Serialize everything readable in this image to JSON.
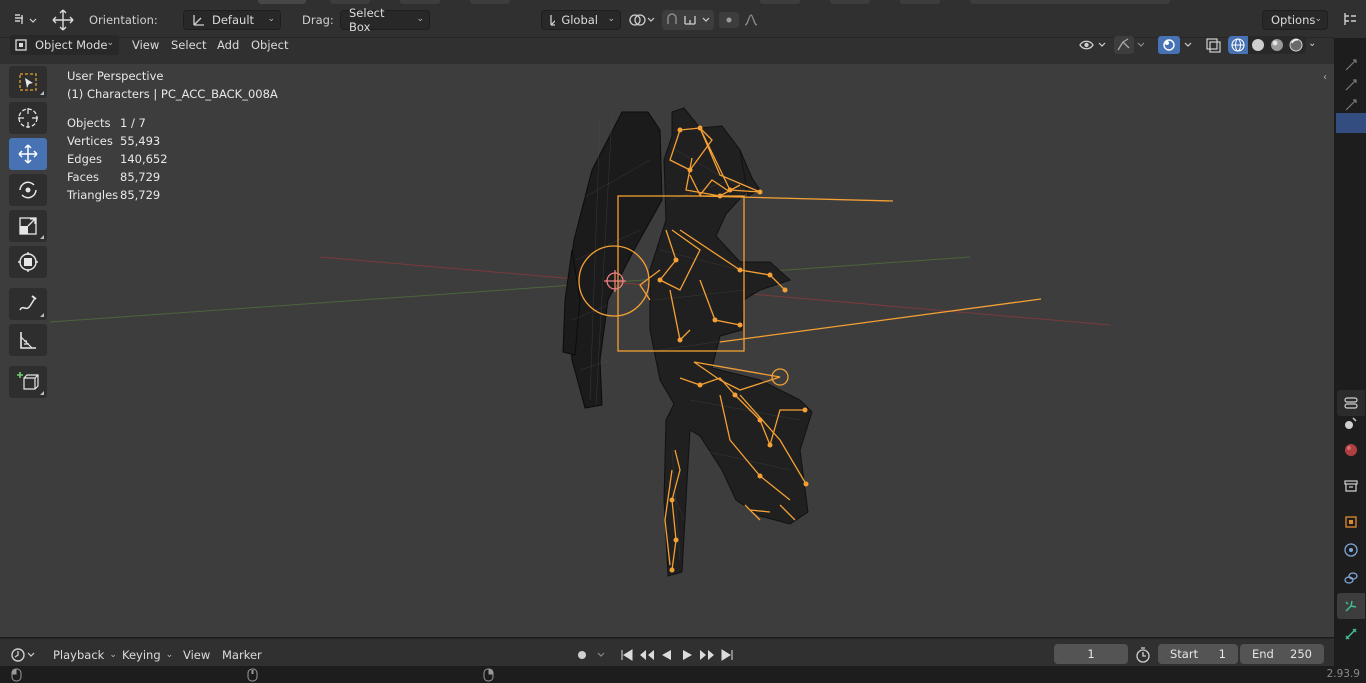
{
  "header": {
    "orientation_label": "Orientation:",
    "orientation_value": "Default",
    "drag_label": "Drag:",
    "drag_value": "Select Box",
    "transform_space": "Global",
    "options_label": "Options"
  },
  "viewport_header": {
    "mode": "Object Mode",
    "menus": [
      "View",
      "Select",
      "Add",
      "Object"
    ]
  },
  "overlay": {
    "view_name": "User Perspective",
    "collection_line": "(1) Characters | PC_ACC_BACK_008A",
    "stats": [
      {
        "key": "Objects",
        "value": "1 / 7"
      },
      {
        "key": "Vertices",
        "value": "55,493"
      },
      {
        "key": "Edges",
        "value": "140,652"
      },
      {
        "key": "Faces",
        "value": "85,729"
      },
      {
        "key": "Triangles",
        "value": "85,729"
      }
    ]
  },
  "toolbar": {
    "tools": [
      "select-box-tool",
      "cursor-tool",
      "move-tool",
      "rotate-tool",
      "scale-tool",
      "transform-tool",
      "annotate-tool",
      "measure-tool",
      "add-cube-tool"
    ],
    "active_tool": "move-tool"
  },
  "timeline": {
    "menus": [
      "Playback",
      "Keying",
      "View",
      "Marker"
    ],
    "current_frame": "1",
    "start_label": "Start",
    "start_value": "1",
    "end_label": "End",
    "end_value": "250"
  },
  "status": {
    "version": "2.93.9"
  },
  "colors": {
    "accent": "#4772b3",
    "armature": "#f5a034",
    "viewport_bg": "#3d3d3d",
    "axis_x": "#8a3a3a",
    "axis_y": "#4c6b3a"
  }
}
